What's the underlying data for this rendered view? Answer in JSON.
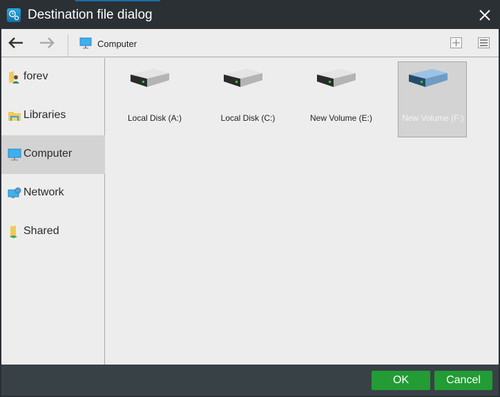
{
  "window": {
    "title": "Destination file dialog",
    "app_icon": "backup-gear-icon",
    "close_icon": "close-icon"
  },
  "toolbar": {
    "back_icon": "arrow-left-icon",
    "forward_icon": "arrow-right-icon",
    "breadcrumb": "Computer",
    "breadcrumb_icon": "monitor-icon",
    "new_folder_icon": "plus-box-icon",
    "view_icon": "list-view-icon"
  },
  "sidebar": {
    "items": [
      {
        "label": "forev",
        "icon": "user-folder-icon",
        "selected": false
      },
      {
        "label": "Libraries",
        "icon": "libraries-folder-icon",
        "selected": false
      },
      {
        "label": "Computer",
        "icon": "monitor-icon",
        "selected": true
      },
      {
        "label": "Network",
        "icon": "network-icon",
        "selected": false
      },
      {
        "label": "Shared",
        "icon": "shared-folder-icon",
        "selected": false
      }
    ]
  },
  "drives": [
    {
      "label": "Local Disk (A:)",
      "icon": "hard-drive-icon",
      "selected": false
    },
    {
      "label": "Local Disk (C:)",
      "icon": "hard-drive-icon",
      "selected": false
    },
    {
      "label": "New Volume (E:)",
      "icon": "hard-drive-icon",
      "selected": false
    },
    {
      "label": "New Volume (F:)",
      "icon": "hard-drive-icon",
      "selected": true
    }
  ],
  "footer": {
    "ok_label": "OK",
    "cancel_label": "Cancel"
  },
  "colors": {
    "titlebar": "#2b3035",
    "footer": "#384145",
    "button_green": "#239c35",
    "selection": "#d3d3d3",
    "accent_blue": "#1a6fa8"
  }
}
